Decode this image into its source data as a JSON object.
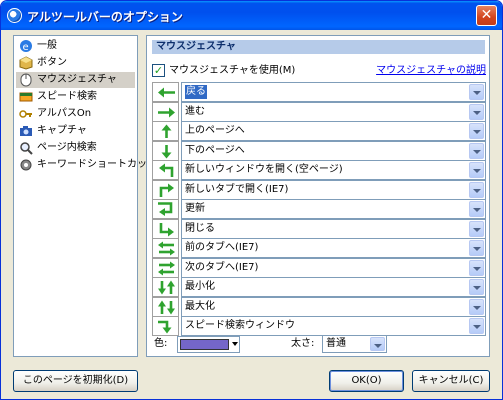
{
  "window": {
    "title": "アルツールバーのオプション",
    "close": "✕"
  },
  "nav": {
    "items": [
      {
        "label": "一般",
        "icon": "ie-icon"
      },
      {
        "label": "ボタン",
        "icon": "cube-icon"
      },
      {
        "label": "マウスジェスチャ",
        "icon": "mouse-icon",
        "selected": true
      },
      {
        "label": "スピード検索",
        "icon": "speed-search-icon"
      },
      {
        "label": "アルパスOn",
        "icon": "key-icon"
      },
      {
        "label": "キャプチャ",
        "icon": "camera-icon"
      },
      {
        "label": "ページ内検索",
        "icon": "magnifier-icon"
      },
      {
        "label": "キーワードショートカット",
        "icon": "gear-icon"
      }
    ]
  },
  "gesture": {
    "section_title": "マウスジェスチャ",
    "enable_label": "マウスジェスチャを使用(M)",
    "enable_checked": "✓",
    "help_link": "マウスジェスチャの説明",
    "rows": [
      {
        "arrow": "left",
        "action": "戻る"
      },
      {
        "arrow": "right",
        "action": "進む"
      },
      {
        "arrow": "up",
        "action": "上のページへ"
      },
      {
        "arrow": "down",
        "action": "下のページへ"
      },
      {
        "arrow": "down-left",
        "action": "新しいウィンドウを開く(空ページ)"
      },
      {
        "arrow": "up-right",
        "action": "新しいタブで開く(IE7)"
      },
      {
        "arrow": "right-down-left",
        "action": "更新"
      },
      {
        "arrow": "down-right",
        "action": "閉じる"
      },
      {
        "arrow": "left-right",
        "action": "前のタブへ(IE7)"
      },
      {
        "arrow": "right-left",
        "action": "次のタブへ(IE7)"
      },
      {
        "arrow": "down-up",
        "action": "最小化"
      },
      {
        "arrow": "up-down",
        "action": "最大化"
      },
      {
        "arrow": "right-down",
        "action": "スピード検索ウィンドウ"
      }
    ],
    "color_label": "色:",
    "color_value": "#7466c8",
    "size_label": "太さ:",
    "size_value": "普通"
  },
  "buttons": {
    "reset": "このページを初期化(D)",
    "ok": "OK(O)",
    "cancel": "キャンセル(C)"
  },
  "colors": {
    "arrow_green": "#2fa32f",
    "accent_blue": "#316ac5"
  }
}
